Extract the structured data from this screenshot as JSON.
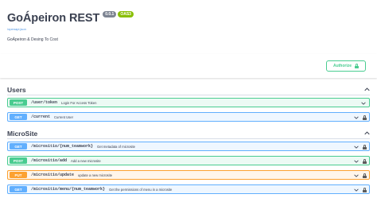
{
  "info": {
    "title": "GoÁpeiron REST",
    "version_badge": "0.0.1",
    "oas_badge": "OAS3",
    "spec_link": "/openapi.json",
    "description": "GoÁpeiron & Desing To Cost"
  },
  "authorize": {
    "label": "Authorize"
  },
  "tags": [
    {
      "name": "Users",
      "operations": [
        {
          "method": "POST",
          "path": "/user/token",
          "summary": "Login For Access Token",
          "locked": false
        },
        {
          "method": "GET",
          "path": "/current",
          "summary": "Current User",
          "locked": true
        }
      ]
    },
    {
      "name": "MicroSite",
      "operations": [
        {
          "method": "GET",
          "path": "/micrositio/{num_teamwork}",
          "summary": "Get metadata of microsite",
          "locked": true
        },
        {
          "method": "POST",
          "path": "/micrositio/add",
          "summary": "Add a new microsite",
          "locked": true
        },
        {
          "method": "PUT",
          "path": "/micrositio/update",
          "summary": "update a new microsite",
          "locked": true
        },
        {
          "method": "GET",
          "path": "/micrositio/menu/{num_teamwork}",
          "summary": "Get the permissions of menu in a microsite",
          "locked": true
        }
      ]
    }
  ],
  "colors": {
    "post": "#49cc90",
    "get": "#61affe",
    "put": "#fca130",
    "link": "#4990e2",
    "text": "#3b4151"
  },
  "icons": {
    "tag_toggle": "chevron-up-icon",
    "op_toggle": "chevron-down-icon",
    "lock": "lock-icon"
  }
}
